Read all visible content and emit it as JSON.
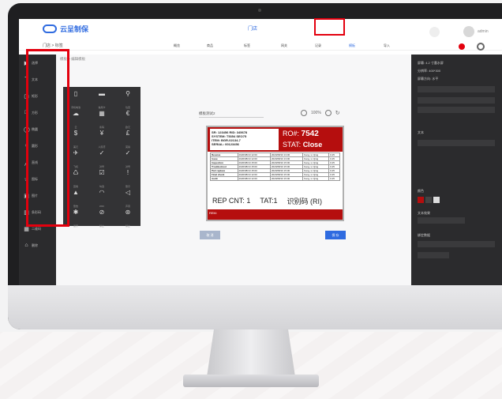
{
  "header": {
    "logo_text": "云呈制保",
    "center_title": "门店",
    "breadcrumb": "门店 > 标签",
    "nav": [
      "概览",
      "商品",
      "标签",
      "网关",
      "记录",
      "模板",
      "导入"
    ],
    "active_nav": "模板",
    "user": "admin"
  },
  "sidebar": {
    "items": [
      {
        "icon": "▶",
        "label": "选择"
      },
      {
        "icon": "T",
        "label": "文本"
      },
      {
        "icon": "▢",
        "label": "矩形"
      },
      {
        "icon": "□",
        "label": "方形"
      },
      {
        "icon": "◯",
        "label": "椭圆"
      },
      {
        "icon": "○",
        "label": "圆形"
      },
      {
        "icon": "╱",
        "label": "直线"
      },
      {
        "icon": "☆",
        "label": "图标"
      },
      {
        "icon": "▣",
        "label": "图片"
      },
      {
        "icon": "▥",
        "label": "条形码"
      },
      {
        "icon": "▦",
        "label": "二维码"
      },
      {
        "icon": "⌂",
        "label": "删除"
      }
    ]
  },
  "breadcrumb": "模板 > 编辑模板",
  "icon_popup": [
    {
      "g": "▯",
      "l": "手机电池"
    },
    {
      "g": "▬",
      "l": "信用卡"
    },
    {
      "g": "⚲",
      "l": "位置"
    },
    {
      "g": "☁",
      "l": "云"
    },
    {
      "g": "▦",
      "l": "条码"
    },
    {
      "g": "€",
      "l": "欧元"
    },
    {
      "g": "$",
      "l": "美元"
    },
    {
      "g": "¥",
      "l": "人民币"
    },
    {
      "g": "£",
      "l": "英镑"
    },
    {
      "g": "✈",
      "l": "飞机"
    },
    {
      "g": "✓",
      "l": "对号"
    },
    {
      "g": "✓",
      "l": "对号"
    },
    {
      "g": "♺",
      "l": "回收"
    },
    {
      "g": "☑",
      "l": "勾选"
    },
    {
      "g": "!",
      "l": "警示"
    },
    {
      "g": "▲",
      "l": "警告"
    },
    {
      "g": "◠",
      "l": "WIFI"
    },
    {
      "g": "◁",
      "l": "声音"
    },
    {
      "g": "✱",
      "l": "蓝牙"
    },
    {
      "g": "⊘",
      "l": "禁止"
    },
    {
      "g": "⊛",
      "l": "禁止"
    }
  ],
  "editor": {
    "template_name": "模板测试2",
    "zoom": "100%",
    "card": {
      "sr": "SR: 123456   RID: 345678",
      "system": "SYSTEM: T5354 SEO75",
      "item": "ITEM:    BGR-02134-7",
      "serial": "SERIAL: 00123456",
      "ro_label": "RO#:",
      "ro_value": "7542",
      "stat_label": "STAT:",
      "stat_value": "Close",
      "rows": [
        [
          "Receive",
          "2020/08/10 12:00",
          "2020/08/10 13:00",
          "Feng, Li Qing",
          "0.25"
        ],
        [
          "Issue",
          "2020/08/10 12:00",
          "2020/08/10 13:00",
          "Feng, Li Qing",
          "0.25"
        ],
        [
          "Inspection",
          "2020/08/10 15:00",
          "2020/08/10 15:00",
          "Feng, Li Qing",
          "0.25"
        ],
        [
          "Troubleshoot",
          "2020/08/10 15:00",
          "2020/08/10 15:00",
          "Feng, Li Qing",
          "0.25"
        ],
        [
          "Part replace",
          "2020/08/10 15:00",
          "2020/08/10 15:00",
          "Feng, Li Qing",
          "0.25"
        ],
        [
          "Final check",
          "2020/08/10 12:00",
          "2020/08/10 15:00",
          "Feng, Li Qing",
          "0.25"
        ],
        [
          "Audit",
          "2020/08/10 12:00",
          "2020/08/10 15:00",
          "Feng, Li Qing",
          "0.25"
        ]
      ],
      "rep_cnt": "REP CNT: 1",
      "tat": "TAT:1",
      "id_code": "识别码 (RI)",
      "rem": "REM:"
    },
    "cancel": "取 消",
    "save": "保 存"
  },
  "right_panel": {
    "screen": "屏幕: 4.2 寸墨水屏",
    "resolution": "分辨率: 400*300",
    "direction": "屏幕方向: 水平",
    "text_label": "文本",
    "color_label": "颜色",
    "text_effect": "文本效果",
    "binding": "绑定数据",
    "colors": [
      "#b50e0e",
      "#444444",
      "#dddddd"
    ]
  }
}
